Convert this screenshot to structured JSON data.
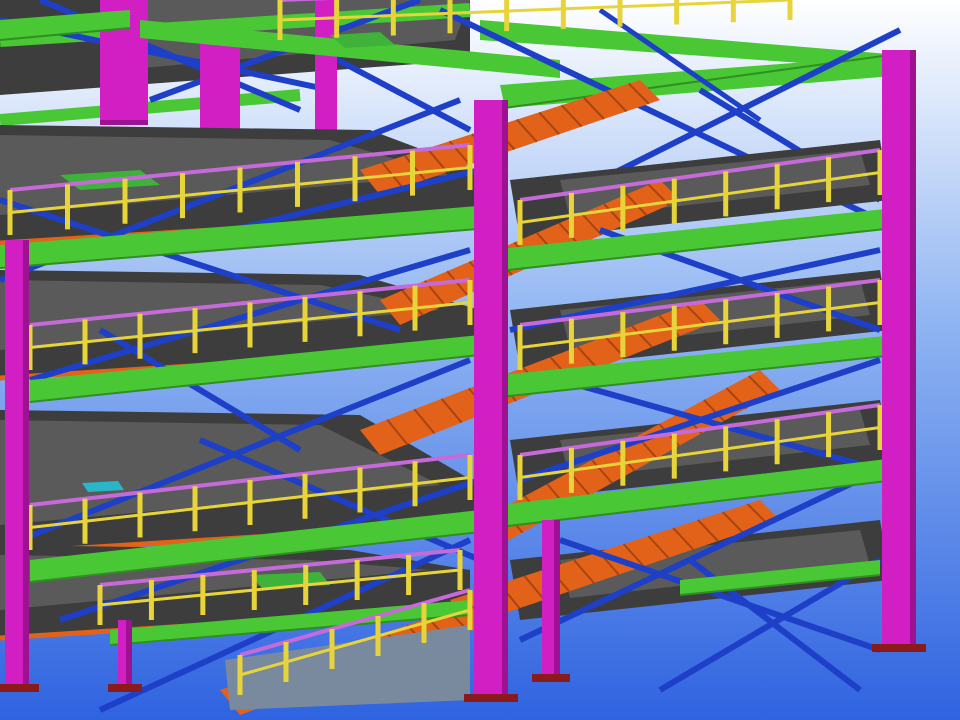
{
  "scene": {
    "subject": "steel-frame-structure-3d-model",
    "colors": {
      "sky_top": "#ffffff",
      "sky_mid": "#8fb4f2",
      "sky_bottom": "#2f63e0",
      "column": "#d21fc4",
      "column_dark": "#9c1290",
      "beam": "#49c735",
      "beam_dark": "#2f8f22",
      "brace": "#1e3fc8",
      "stair": "#e2621a",
      "stair_dark": "#a84410",
      "rail": "#e7d43b",
      "handrail": "#c56ad8",
      "deck": "#3d3d3d",
      "deck_light": "#5a5a5a",
      "base_plate": "#8b1a1a",
      "hatch": "#3fb23a",
      "hatch_cyan": "#2bb6c8"
    }
  }
}
